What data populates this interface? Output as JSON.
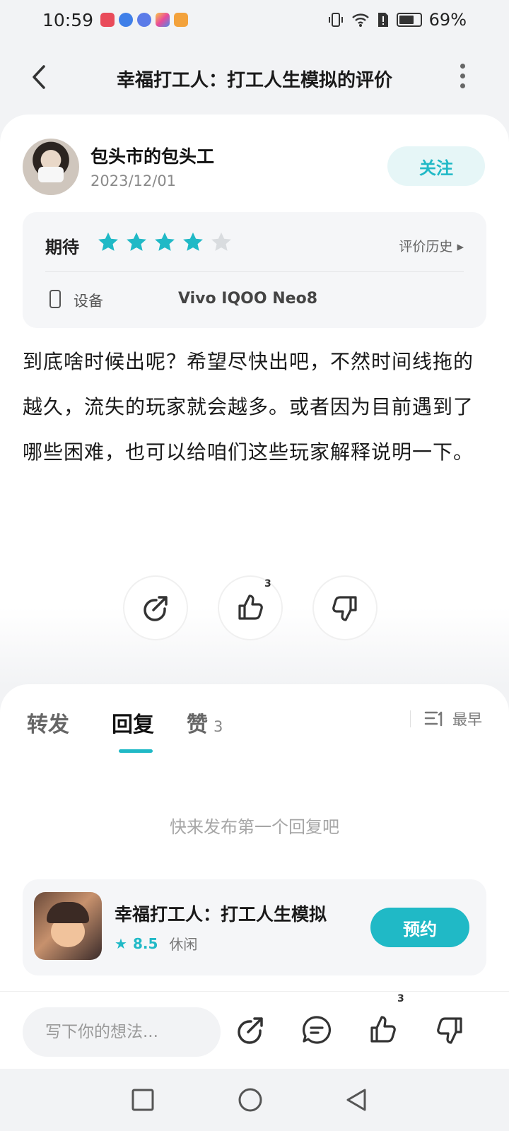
{
  "status_bar": {
    "time": "10:59",
    "battery_text": "69%"
  },
  "nav": {
    "title": "幸福打工人：打工人生模拟的评价"
  },
  "author": {
    "name": "包头市的包头工",
    "date": "2023/12/01",
    "follow_label": "关注"
  },
  "rating": {
    "label": "期待",
    "stars": 4,
    "max_stars": 5,
    "history_label": "评价历史",
    "device_label": "设备",
    "device_value": "Vivo IQOO Neo8"
  },
  "review": {
    "text": "到底啥时候出呢？希望尽快出吧，不然时间线拖的越久，流失的玩家就会越多。或者因为目前遇到了哪些困难，也可以给咱们这些玩家解释说明一下。"
  },
  "actions": {
    "like_count": "3"
  },
  "tabs": [
    {
      "label": "转发",
      "count": ""
    },
    {
      "label": "回复",
      "count": ""
    },
    {
      "label": "赞",
      "count": "3"
    }
  ],
  "sort_label": "最早",
  "empty_text": "快来发布第一个回复吧",
  "game": {
    "title": "幸福打工人：打工人生模拟",
    "score": "8.5",
    "genre": "休闲",
    "reserve_label": "预约"
  },
  "bottom_bar": {
    "input_placeholder": "写下你的想法...",
    "like_count": "3"
  },
  "colors": {
    "accent": "#20b9c6",
    "star_empty": "#d9dcdf"
  }
}
